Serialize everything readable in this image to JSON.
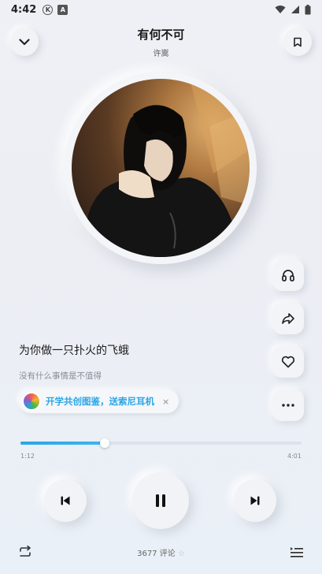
{
  "status_bar": {
    "time": "4:42",
    "notif1": "K",
    "notif2": "A"
  },
  "header": {
    "title": "有何不可",
    "artist": "许嵩"
  },
  "lyrics": {
    "current": "为你做一只扑火的飞蛾",
    "next": "没有什么事情是不值得"
  },
  "promo": {
    "text": "开学共创图鉴，送索尼耳机",
    "close": "×"
  },
  "player": {
    "elapsed": "1:12",
    "duration": "4:01",
    "progress": 0.3
  },
  "footer": {
    "comments_label": "3677 评论",
    "comments_star": "☆"
  },
  "colors": {
    "accent": "#2aa6e6",
    "background": "#eef0f5"
  }
}
